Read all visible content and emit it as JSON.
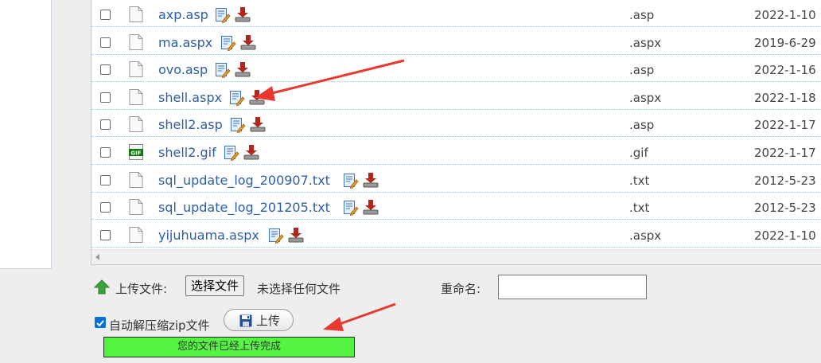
{
  "files": [
    {
      "name": "axp.asp",
      "ext": ".asp",
      "date": "2022-1-10",
      "type": "file"
    },
    {
      "name": "ma.aspx",
      "ext": ".aspx",
      "date": "2019-6-29",
      "type": "file"
    },
    {
      "name": "ovo.asp",
      "ext": ".asp",
      "date": "2022-1-16",
      "type": "file"
    },
    {
      "name": "shell.aspx",
      "ext": ".aspx",
      "date": "2022-1-18",
      "type": "file"
    },
    {
      "name": "shell2.asp",
      "ext": ".asp",
      "date": "2022-1-17",
      "type": "file"
    },
    {
      "name": "shell2.gif",
      "ext": ".gif",
      "date": "2022-1-17",
      "type": "gif"
    },
    {
      "name": "sql_update_log_200907.txt",
      "ext": ".txt",
      "date": "2012-5-23",
      "type": "file"
    },
    {
      "name": "sql_update_log_201205.txt",
      "ext": ".txt",
      "date": "2012-5-23",
      "type": "file"
    },
    {
      "name": "yijuhuama.aspx",
      "ext": ".aspx",
      "date": "2022-1-10",
      "type": "file"
    }
  ],
  "upload": {
    "label": "上传文件:",
    "choose_button": "选择文件",
    "no_file_text": "未选择任何文件",
    "rename_label": "重命名:",
    "rename_value": "",
    "zip_label": "自动解压缩zip文件",
    "zip_checked": true,
    "submit_label": "上传",
    "progress_text": "您的文件已经上传完成",
    "progress": 1.0
  },
  "gif_badge": "GIF",
  "icons": {
    "file": "file-icon",
    "gif": "gif-file-icon",
    "edit": "edit-icon",
    "download": "download-icon",
    "upload": "upload-arrow-icon",
    "disk": "floppy-disk-icon"
  },
  "colors": {
    "link": "#2b5ea8",
    "progress": "#55f443",
    "annotation_arrow": "#e8382f",
    "checkbox": "#0a6fd6"
  }
}
